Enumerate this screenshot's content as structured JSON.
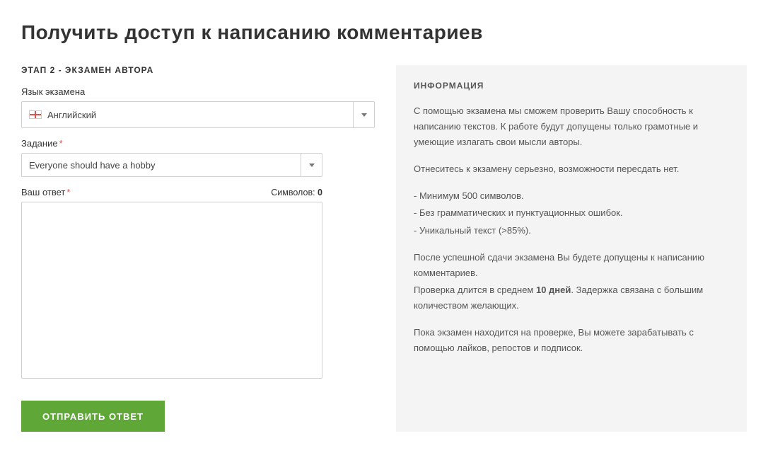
{
  "header": {
    "title": "Получить доступ к написанию комментариев"
  },
  "form": {
    "step_label": "ЭТАП 2 - ЭКЗАМЕН АВТОРА",
    "language": {
      "label": "Язык экзамена",
      "value": "Английский"
    },
    "task": {
      "label": "Задание",
      "value": "Everyone should have a hobby"
    },
    "answer": {
      "label": "Ваш ответ",
      "chars_label": "Символов:",
      "chars_value": "0",
      "value": ""
    },
    "submit_label": "ОТПРАВИТЬ ОТВЕТ"
  },
  "info": {
    "title": "ИНФОРМАЦИЯ",
    "p1": "С помощью экзамена мы сможем проверить Вашу способность к написанию текстов. К работе будут допущены только грамотные и умеющие излагать свои мысли авторы.",
    "p2": "Отнеситесь к экзамену серьезно, возможности пересдать нет.",
    "l1": "- Минимум 500 символов.",
    "l2": "- Без грамматических и пунктуационных ошибок.",
    "l3": "- Уникальный текст (>85%).",
    "p3": "После успешной сдачи экзамена Вы будете допущены к написанию комментариев.",
    "p4a": "Проверка длится в среднем ",
    "p4b": "10 дней",
    "p4c": ". Задержка связана с большим количеством желающих.",
    "p5": "Пока экзамен находится на проверке, Вы можете зарабатывать с помощью лайков, репостов и подписок."
  }
}
